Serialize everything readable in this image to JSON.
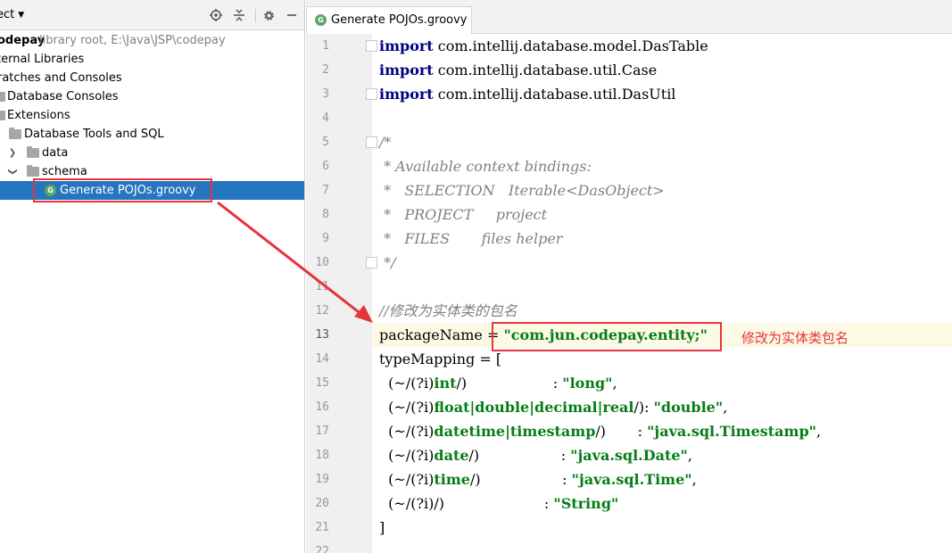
{
  "project_pane": {
    "title": "ect",
    "tree": [
      {
        "label": "odepay",
        "bold": true,
        "detail": "library root,  E:\\Java\\JSP\\codepay"
      },
      {
        "label": "ternal Libraries"
      },
      {
        "label": "ratches and Consoles"
      },
      {
        "label": "Database Consoles"
      },
      {
        "label": "Extensions"
      },
      {
        "label": "Database Tools and SQL"
      },
      {
        "label": "data"
      },
      {
        "label": "schema"
      },
      {
        "label": "Generate POJOs.groovy"
      }
    ],
    "toolbar_icons": [
      "locate-icon",
      "collapse-icon",
      "gear-icon",
      "minimize-icon"
    ]
  },
  "editor": {
    "tab_label": "Generate POJOs.groovy",
    "badge_letter": "G",
    "current_line": 13,
    "line_numbers": [
      "1",
      "2",
      "3",
      "4",
      "5",
      "6",
      "7",
      "8",
      "9",
      "10",
      "11",
      "12",
      "13",
      "14",
      "15",
      "16",
      "17",
      "18",
      "19",
      "20",
      "21",
      "22"
    ],
    "code": {
      "l1_kw": "import",
      "l1_rest": " com.intellij.database.model.DasTable",
      "l2_kw": "import",
      "l2_rest": " com.intellij.database.util.Case",
      "l3_kw": "import",
      "l3_rest": " com.intellij.database.util.DasUtil",
      "l5": "/*",
      "l6": " * Available context bindings:",
      "l7": " *   SELECTION   Iterable<DasObject>",
      "l8": " *   PROJECT     project",
      "l9": " *   FILES       files helper",
      "l10": " */",
      "l12": "//修改为实体类的包名",
      "l13_a": "packageName = ",
      "l13_str": "\"com.jun.codepay.entity;\"",
      "l14": "typeMapping = [",
      "l15_a": "  (~/(?i)",
      "l15_re": "int",
      "l15_b": "/)                   : ",
      "l15_str": "\"long\"",
      "l15_c": ",",
      "l16_a": "  (~/(?i)",
      "l16_re": "float|double|decimal|real",
      "l16_b": "/): ",
      "l16_str": "\"double\"",
      "l16_c": ",",
      "l17_a": "  (~/(?i)",
      "l17_re": "datetime|timestamp",
      "l17_b": "/)       : ",
      "l17_str": "\"java.sql.Timestamp\"",
      "l17_c": ",",
      "l18_a": "  (~/(?i)",
      "l18_re": "date",
      "l18_b": "/)                  : ",
      "l18_str": "\"java.sql.Date\"",
      "l18_c": ",",
      "l19_a": "  (~/(?i)",
      "l19_re": "time",
      "l19_b": "/)                  : ",
      "l19_str": "\"java.sql.Time\"",
      "l19_c": ",",
      "l20_a": "  (~/(?i)",
      "l20_b": "/)                      : ",
      "l20_str": "\"String\"",
      "l21": "]"
    }
  },
  "annotation": {
    "text": "修改为实体类包名",
    "color": "#e8333b"
  },
  "colors": {
    "selection": "#2675bf",
    "current_line": "#fcfae4",
    "gutter": "#f0f0f0",
    "keyword": "#000080",
    "string": "#067d17",
    "comment": "#808080",
    "groovy_badge": "#59a869"
  }
}
